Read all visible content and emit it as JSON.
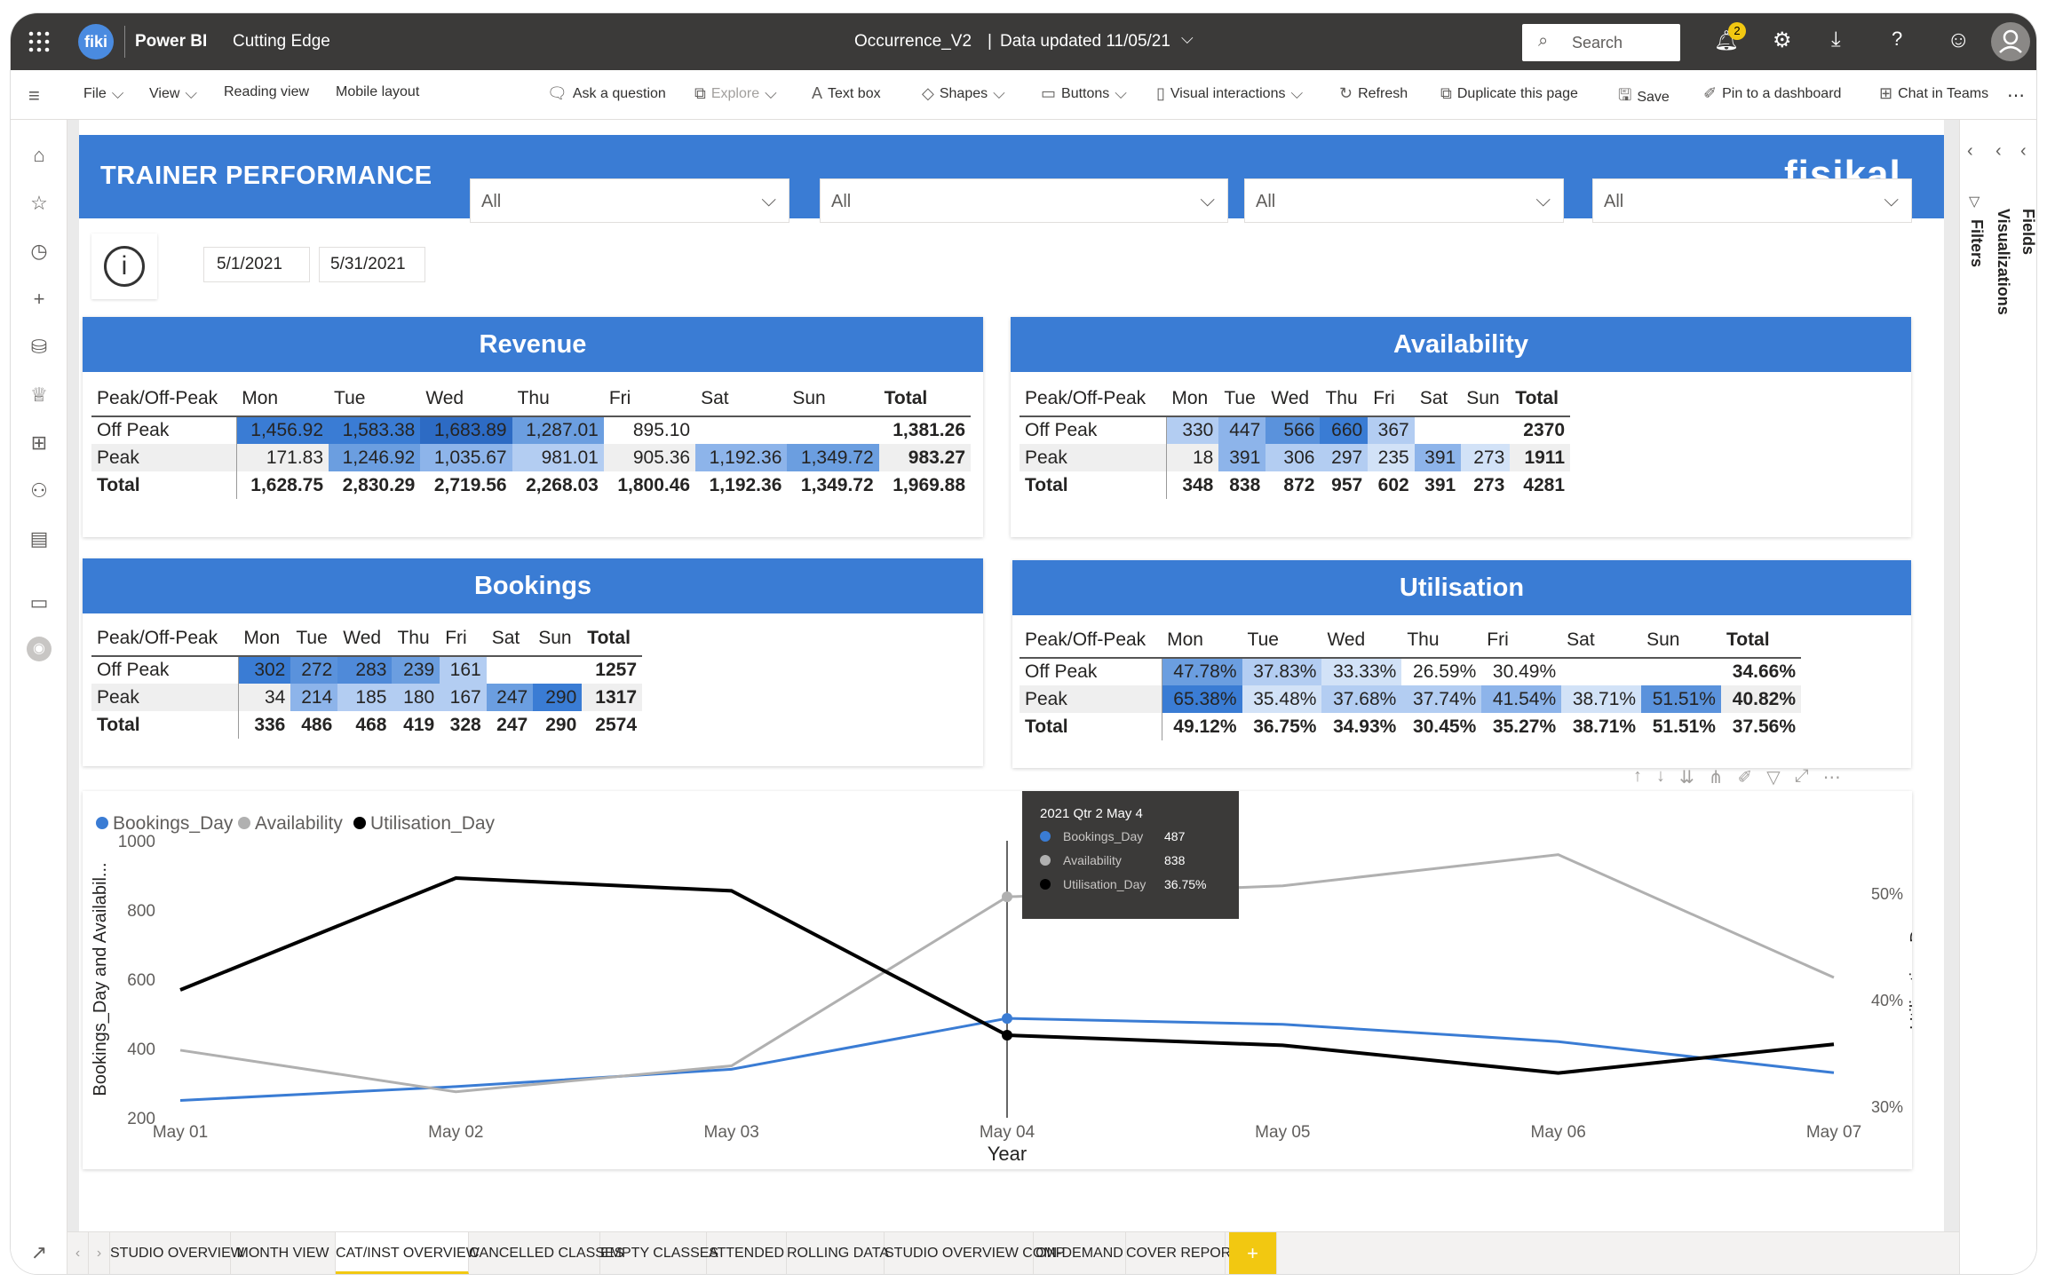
{
  "topbar": {
    "app_name": "Power BI",
    "workspace": "Cutting Edge",
    "report_name": "Occurrence_V2",
    "data_updated": "Data updated 11/05/21",
    "search_placeholder": "Search",
    "notif_count": "2",
    "logo_text": "fiki"
  },
  "cmdbar": {
    "items": [
      "File",
      "View",
      "Reading view",
      "Mobile layout",
      "Ask a question",
      "Explore",
      "Text box",
      "Shapes",
      "Buttons",
      "Visual interactions",
      "Refresh",
      "Duplicate this page",
      "Save",
      "Pin to a dashboard",
      "Chat in Teams"
    ]
  },
  "report": {
    "title": "TRAINER PERFORMANCE",
    "brand": "fisikal",
    "date_from": "5/1/2021",
    "date_to": "5/31/2021",
    "slicers": [
      "All",
      "All",
      "All",
      "All"
    ],
    "info_label": "i"
  },
  "revenue": {
    "title": "Revenue",
    "headers": [
      "Peak/Off-Peak",
      "Mon",
      "Tue",
      "Wed",
      "Thu",
      "Fri",
      "Sat",
      "Sun",
      "Total"
    ],
    "rows": [
      [
        "Off Peak",
        "1,456.92",
        "1,583.38",
        "1,683.89",
        "1,287.01",
        "895.10",
        "",
        "",
        "1,381.26"
      ],
      [
        "Peak",
        "171.83",
        "1,246.92",
        "1,035.67",
        "981.01",
        "905.36",
        "1,192.36",
        "1,349.72",
        "983.27"
      ],
      [
        "Total",
        "1,628.75",
        "2,830.29",
        "2,719.56",
        "2,268.03",
        "1,800.46",
        "1,192.36",
        "1,349.72",
        "1,969.88"
      ]
    ],
    "shade": [
      [
        "#3a7cd4",
        "#3a7cd4",
        "#2d6bc4",
        "#6b9ee0",
        "#fff",
        "#fff",
        "#fff"
      ],
      [
        "#fff",
        "#6b9ee0",
        "#8db4ea",
        "#b3cdf2",
        "#fff",
        "#8db4ea",
        "#6b9ee0"
      ]
    ]
  },
  "availability": {
    "title": "Availability",
    "headers": [
      "Peak/Off-Peak",
      "Mon",
      "Tue",
      "Wed",
      "Thu",
      "Fri",
      "Sat",
      "Sun",
      "Total"
    ],
    "rows": [
      [
        "Off Peak",
        "330",
        "447",
        "566",
        "660",
        "367",
        "",
        "",
        "2370"
      ],
      [
        "Peak",
        "18",
        "391",
        "306",
        "297",
        "235",
        "391",
        "273",
        "1911"
      ],
      [
        "Total",
        "348",
        "838",
        "872",
        "957",
        "602",
        "391",
        "273",
        "4281"
      ]
    ],
    "shade": [
      [
        "#b3cdf2",
        "#8db4ea",
        "#5a92dc",
        "#3a7cd4",
        "#b3cdf2",
        "#fff",
        "#fff"
      ],
      [
        "#fff",
        "#8db4ea",
        "#b3cdf2",
        "#b3cdf2",
        "#d2e2f7",
        "#8db4ea",
        "#d2e2f7"
      ]
    ]
  },
  "bookings": {
    "title": "Bookings",
    "headers": [
      "Peak/Off-Peak",
      "Mon",
      "Tue",
      "Wed",
      "Thu",
      "Fri",
      "Sat",
      "Sun",
      "Total"
    ],
    "rows": [
      [
        "Off Peak",
        "302",
        "272",
        "283",
        "239",
        "161",
        "",
        "",
        "1257"
      ],
      [
        "Peak",
        "34",
        "214",
        "185",
        "180",
        "167",
        "247",
        "290",
        "1317"
      ],
      [
        "Total",
        "336",
        "486",
        "468",
        "419",
        "328",
        "247",
        "290",
        "2574"
      ]
    ],
    "shade": [
      [
        "#3a7cd4",
        "#5a92dc",
        "#4f8ad9",
        "#6b9ee0",
        "#b3cdf2",
        "#fff",
        "#fff"
      ],
      [
        "#fff",
        "#8db4ea",
        "#b3cdf2",
        "#b3cdf2",
        "#b3cdf2",
        "#6b9ee0",
        "#3a7cd4"
      ]
    ]
  },
  "utilisation": {
    "title": "Utilisation",
    "headers": [
      "Peak/Off-Peak",
      "Mon",
      "Tue",
      "Wed",
      "Thu",
      "Fri",
      "Sat",
      "Sun",
      "Total"
    ],
    "rows": [
      [
        "Off Peak",
        "47.78%",
        "37.83%",
        "33.33%",
        "26.59%",
        "30.49%",
        "",
        "",
        "34.66%"
      ],
      [
        "Peak",
        "65.38%",
        "35.48%",
        "37.68%",
        "37.74%",
        "41.54%",
        "38.71%",
        "51.51%",
        "40.82%"
      ],
      [
        "Total",
        "49.12%",
        "36.75%",
        "34.93%",
        "30.45%",
        "35.27%",
        "38.71%",
        "51.51%",
        "37.56%"
      ]
    ],
    "shade": [
      [
        "#6b9ee0",
        "#b3cdf2",
        "#d2e2f7",
        "#fff",
        "#fff",
        "#fff",
        "#fff"
      ],
      [
        "#3a7cd4",
        "#d2e2f7",
        "#b3cdf2",
        "#b3cdf2",
        "#8db4ea",
        "#d2e2f7",
        "#5a92dc"
      ]
    ]
  },
  "chart_data": {
    "type": "line",
    "x": [
      "May 01",
      "May 02",
      "May 03",
      "May 04",
      "May 05",
      "May 06",
      "May 07"
    ],
    "xlabel": "Year",
    "ylabel": "Bookings_Day and Availabil...",
    "y2label": "Utilisation_Day",
    "ylim": [
      200,
      1000
    ],
    "yticks": [
      200,
      400,
      600,
      800,
      1000
    ],
    "y2ticks": [
      "30%",
      "40%",
      "50%"
    ],
    "y2lim": [
      0.29,
      0.55
    ],
    "series": [
      {
        "name": "Bookings_Day",
        "color": "#3a7cd4",
        "axis": "left",
        "values": [
          250,
          290,
          340,
          487,
          470,
          420,
          330
        ]
      },
      {
        "name": "Availability",
        "color": "#b0b0b0",
        "axis": "left",
        "values": [
          395,
          275,
          350,
          838,
          870,
          960,
          605
        ]
      },
      {
        "name": "Utilisation_Day",
        "color": "#000000",
        "axis": "right",
        "values": [
          0.41,
          0.515,
          0.503,
          0.3675,
          0.358,
          0.332,
          0.359
        ]
      }
    ],
    "tooltip": {
      "title": "2021 Qtr 2 May 4",
      "rows": [
        [
          "Bookings_Day",
          "487"
        ],
        [
          "Availability",
          "838"
        ],
        [
          "Utilisation_Day",
          "36.75%"
        ]
      ]
    }
  },
  "tabs": [
    "STUDIO OVERVIEW",
    "MONTH VIEW",
    "CAT/INST OVERVIEW",
    "CANCELLED CLASSES",
    "EMPTY CLASSES",
    "ATTENDED",
    "ROLLING DATA",
    "STUDIO OVERVIEW COMP",
    "ON-DEMAND",
    "COVER REPORT"
  ],
  "active_tab": "CAT/INST OVERVIEW",
  "add_tab": "+",
  "panes": {
    "filters": "Filters",
    "visualizations": "Visualizations",
    "fields": "Fields"
  }
}
